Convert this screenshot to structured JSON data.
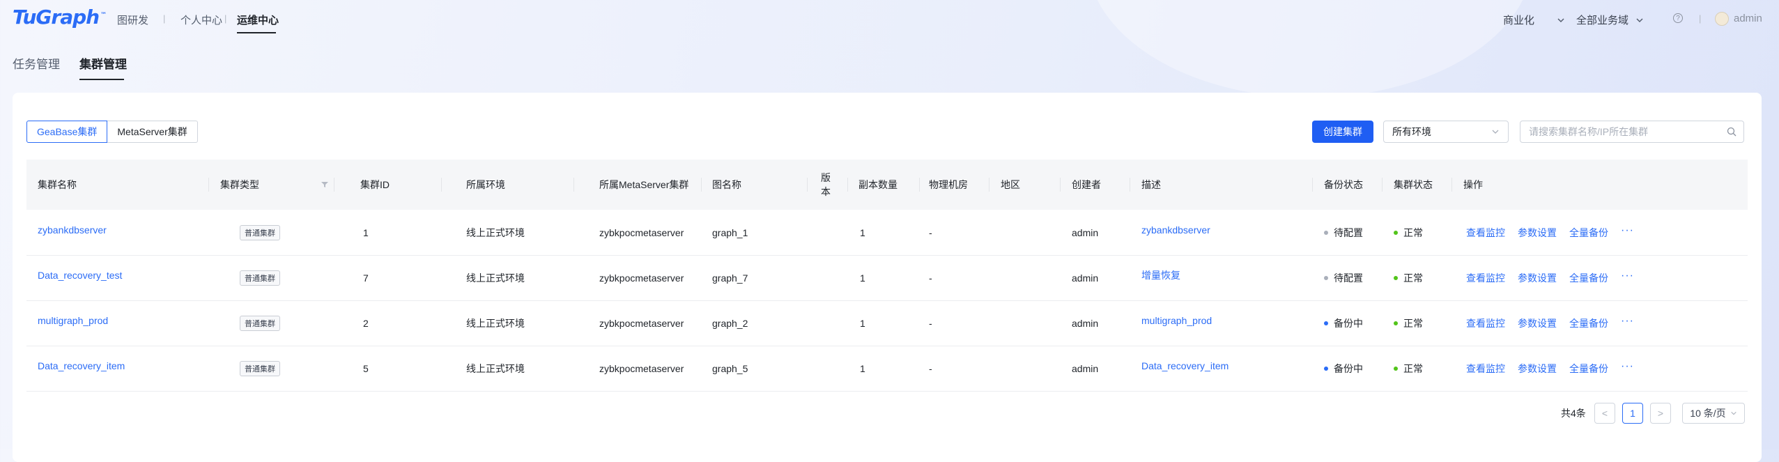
{
  "app": {
    "logo_text": "TuGraph",
    "logo_tm": "™",
    "nav": [
      {
        "label": "图研发"
      },
      {
        "label": "个人中心"
      },
      {
        "label": "运维中心"
      }
    ],
    "nav_separators": [
      "|",
      "|",
      "|"
    ],
    "right": {
      "commercial": "商业化",
      "domain": "全部业务域",
      "help_icon": "question-circle-icon",
      "user": "admin"
    }
  },
  "subtabs": [
    {
      "label": "任务管理"
    },
    {
      "label": "集群管理"
    }
  ],
  "toolbar": {
    "segments": [
      "GeaBase集群",
      "MetaServer集群"
    ],
    "create_label": "创建集群",
    "env_select_value": "所有环境",
    "search_placeholder": "请搜索集群名称/IP所在集群"
  },
  "table": {
    "headers": [
      "集群名称",
      "集群类型",
      "集群ID",
      "所属环境",
      "所属MetaServer集群",
      "图名称",
      "版本",
      "副本数量",
      "物理机房",
      "地区",
      "创建者",
      "描述",
      "备份状态",
      "集群状态",
      "操作"
    ],
    "version_header_line1": "版",
    "version_header_line2": "本",
    "rows": [
      {
        "name": "zybankdbserver",
        "type": "普通集群",
        "id": "1",
        "env": "线上正式环境",
        "meta": "zybkpocmetaserver",
        "graph": "graph_1",
        "version": "",
        "replicas": "1",
        "room": "-",
        "region": "",
        "creator": "admin",
        "desc": "zybankdbserver",
        "backup": "待配置",
        "status": "正常"
      },
      {
        "name": "Data_recovery_test",
        "type": "普通集群",
        "id": "7",
        "env": "线上正式环境",
        "meta": "zybkpocmetaserver",
        "graph": "graph_7",
        "version": "",
        "replicas": "1",
        "room": "-",
        "region": "",
        "creator": "admin",
        "desc": "增量恢复",
        "backup": "待配置",
        "status": "正常"
      },
      {
        "name": "multigraph_prod",
        "type": "普通集群",
        "id": "2",
        "env": "线上正式环境",
        "meta": "zybkpocmetaserver",
        "graph": "graph_2",
        "version": "",
        "replicas": "1",
        "room": "-",
        "region": "",
        "creator": "admin",
        "desc": "multigraph_prod",
        "backup": "备份中",
        "status": "正常"
      },
      {
        "name": "Data_recovery_item",
        "type": "普通集群",
        "id": "5",
        "env": "线上正式环境",
        "meta": "zybkpocmetaserver",
        "graph": "graph_5",
        "version": "",
        "replicas": "1",
        "room": "-",
        "region": "",
        "creator": "admin",
        "desc": "Data_recovery_item",
        "backup": "备份中",
        "status": "正常"
      }
    ],
    "actions": [
      "查看监控",
      "参数设置",
      "全量备份"
    ],
    "more": "···"
  },
  "pagination": {
    "total": "共4条",
    "prev": "<",
    "current": "1",
    "next": ">",
    "page_size": "10 条/页"
  },
  "colors": {
    "primary": "#1f5ef3",
    "link": "#2b6cf6",
    "status_ok": "#52c41a",
    "backup_pending": "#a9afba",
    "backup_running": "#2b6cf6"
  }
}
